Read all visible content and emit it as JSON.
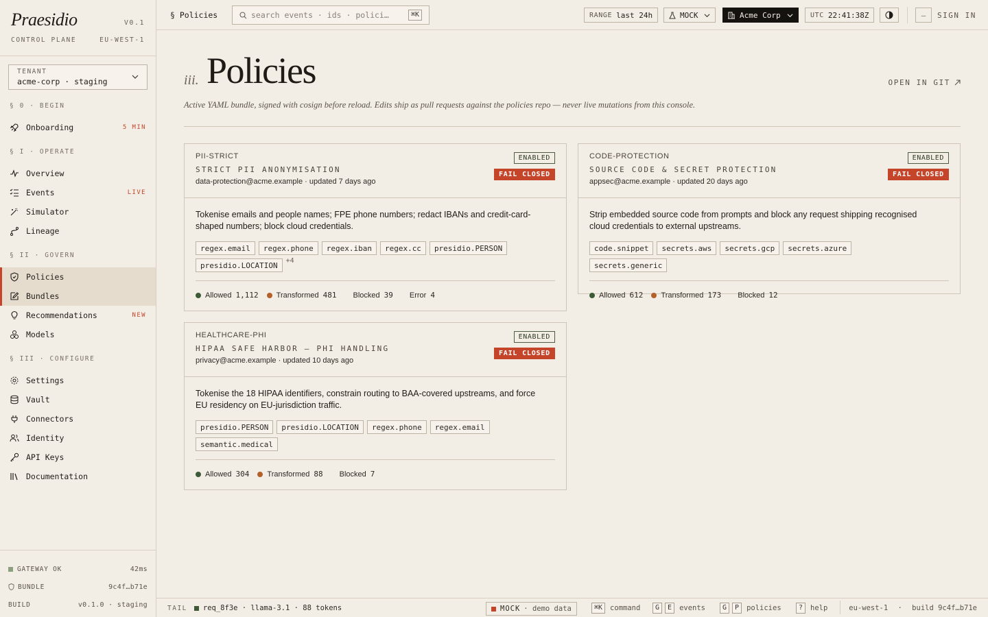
{
  "brand": {
    "name": "Praesidio",
    "version": "V0.1",
    "subtitle": "CONTROL PLANE",
    "region": "EU-WEST-1"
  },
  "tenant": {
    "label": "TENANT",
    "value": "acme-corp · staging"
  },
  "nav": {
    "sections": [
      {
        "title": "§ 0 · BEGIN",
        "items": [
          {
            "label": "Onboarding",
            "icon": "rocket-icon",
            "badge": "5 MIN"
          }
        ]
      },
      {
        "title": "§ I · OPERATE",
        "items": [
          {
            "label": "Overview",
            "icon": "pulse-icon",
            "badge": ""
          },
          {
            "label": "Events",
            "icon": "list-check-icon",
            "badge": "LIVE"
          },
          {
            "label": "Simulator",
            "icon": "wand-icon",
            "badge": ""
          },
          {
            "label": "Lineage",
            "icon": "branch-icon",
            "badge": ""
          }
        ]
      },
      {
        "title": "§ II · GOVERN",
        "items": [
          {
            "label": "Policies",
            "icon": "shield-icon",
            "badge": ""
          },
          {
            "label": "Bundles",
            "icon": "edit-icon",
            "badge": ""
          },
          {
            "label": "Recommendations",
            "icon": "bulb-icon",
            "badge": "NEW"
          },
          {
            "label": "Models",
            "icon": "cubes-icon",
            "badge": ""
          }
        ]
      },
      {
        "title": "§ III · CONFIGURE",
        "items": [
          {
            "label": "Settings",
            "icon": "gear-icon",
            "badge": ""
          },
          {
            "label": "Vault",
            "icon": "database-icon",
            "badge": ""
          },
          {
            "label": "Connectors",
            "icon": "plug-icon",
            "badge": ""
          },
          {
            "label": "Identity",
            "icon": "users-icon",
            "badge": ""
          },
          {
            "label": "API Keys",
            "icon": "key-icon",
            "badge": ""
          },
          {
            "label": "Documentation",
            "icon": "books-icon",
            "badge": ""
          }
        ]
      }
    ]
  },
  "sidebar_footer": {
    "gateway_label": "GATEWAY OK",
    "gateway_value": "42ms",
    "bundle_label": "BUNDLE",
    "bundle_value": "9c4f…b71e",
    "build_label": "BUILD",
    "build_value": "v0.1.0 · staging"
  },
  "topbar": {
    "breadcrumb": "§ Policies",
    "search_placeholder": "search events · ids · polici…",
    "search_kbd": "⌘K",
    "range_label": "RANGE",
    "range_value": "last 24h",
    "mode": "MOCK",
    "org": "Acme Corp",
    "clock_label": "UTC",
    "clock_value": "22:41:38Z",
    "collapse": "–",
    "signin": "SIGN IN"
  },
  "page": {
    "number": "iii.",
    "title": "Policies",
    "git_link": "OPEN IN GIT",
    "description": "Active YAML bundle, signed with cosign before reload. Edits ship as pull requests against the policies repo — never live mutations from this console."
  },
  "policies": [
    {
      "id": "PII-STRICT",
      "name": "STRICT PII ANONYMISATION",
      "meta": "data-protection@acme.example · updated 7 days ago",
      "status": "ENABLED",
      "mode": "FAIL CLOSED",
      "description": "Tokenise emails and people names; FPE phone numbers; redact IBANs and credit-card-shaped numbers; block cloud credentials.",
      "tags": [
        "regex.email",
        "regex.phone",
        "regex.iban",
        "regex.cc",
        "presidio.PERSON",
        "presidio.LOCATION"
      ],
      "more": "+4",
      "stats": [
        {
          "label": "Allowed",
          "value": "1,112",
          "color": "#3d5a37"
        },
        {
          "label": "Transformed",
          "value": "481",
          "color": "#b4602a"
        },
        {
          "label": "Blocked",
          "value": "39",
          "color": ""
        },
        {
          "label": "Error",
          "value": "4",
          "color": ""
        }
      ]
    },
    {
      "id": "CODE-PROTECTION",
      "name": "SOURCE CODE & SECRET PROTECTION",
      "meta": "appsec@acme.example · updated 20 days ago",
      "status": "ENABLED",
      "mode": "FAIL CLOSED",
      "description": "Strip embedded source code from prompts and block any request shipping recognised cloud credentials to external upstreams.",
      "tags": [
        "code.snippet",
        "secrets.aws",
        "secrets.gcp",
        "secrets.azure",
        "secrets.generic"
      ],
      "more": "",
      "stats": [
        {
          "label": "Allowed",
          "value": "612",
          "color": "#3d5a37"
        },
        {
          "label": "Transformed",
          "value": "173",
          "color": "#b4602a"
        },
        {
          "label": "Blocked",
          "value": "12",
          "color": ""
        }
      ]
    },
    {
      "id": "HEALTHCARE-PHI",
      "name": "HIPAA SAFE HARBOR — PHI HANDLING",
      "meta": "privacy@acme.example · updated 10 days ago",
      "status": "ENABLED",
      "mode": "FAIL CLOSED",
      "description": "Tokenise the 18 HIPAA identifiers, constrain routing to BAA-covered upstreams, and force EU residency on EU-jurisdiction traffic.",
      "tags": [
        "presidio.PERSON",
        "presidio.LOCATION",
        "regex.phone",
        "regex.email",
        "semantic.medical"
      ],
      "more": "",
      "stats": [
        {
          "label": "Allowed",
          "value": "304",
          "color": "#3d5a37"
        },
        {
          "label": "Transformed",
          "value": "88",
          "color": "#b4602a"
        },
        {
          "label": "Blocked",
          "value": "7",
          "color": ""
        }
      ]
    }
  ],
  "statusbar": {
    "tail_label": "TAIL",
    "tail_value": "req_8f3e · llama-3.1 · 88 tokens",
    "mock_label": "MOCK",
    "mock_value": "· demo data",
    "hints": [
      {
        "keys": [
          "⌘K"
        ],
        "label": "command"
      },
      {
        "keys": [
          "G",
          "E"
        ],
        "label": "events"
      },
      {
        "keys": [
          "G",
          "P"
        ],
        "label": "policies"
      },
      {
        "keys": [
          "?"
        ],
        "label": "help"
      }
    ],
    "region": "eu-west-1",
    "build": "build 9c4f…b71e"
  },
  "colors": {
    "accent": "#c4452a",
    "ok": "#3d5a37",
    "transform": "#b4602a",
    "paper": "#f3eee5"
  }
}
